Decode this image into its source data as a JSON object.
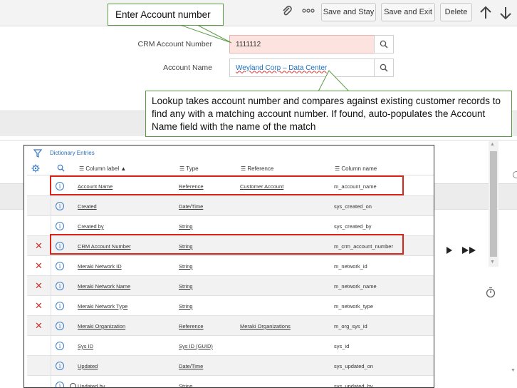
{
  "toolbar": {
    "save_stay_label": "Save and Stay",
    "save_exit_label": "Save and Exit",
    "delete_label": "Delete",
    "more_icon": "more-icon",
    "attach_icon": "paperclip-icon"
  },
  "form": {
    "crm_label": "CRM Account Number",
    "crm_value": "1111112",
    "account_label": "Account Name",
    "account_value": "Weyland Corp – Data Center"
  },
  "callouts": {
    "enter_account": "Enter Account number",
    "lookup_note": "Lookup takes account number and compares against existing customer records to find any with a matching account number.  If found, auto-populates the Account Name field with the name of the match"
  },
  "dictionary": {
    "title": "Dictionary Entries",
    "headers": {
      "column_label": "Column label ▲",
      "type": "Type",
      "reference": "Reference",
      "column_name": "Column name"
    },
    "rows": [
      {
        "deletable": false,
        "label": "Account Name",
        "type": "Reference",
        "reference": "Customer Account",
        "name": "m_account_name"
      },
      {
        "deletable": false,
        "label": "Created",
        "type": "Date/Time",
        "reference": "",
        "name": "sys_created_on"
      },
      {
        "deletable": false,
        "label": "Created by",
        "type": "String",
        "reference": "",
        "name": "sys_created_by"
      },
      {
        "deletable": true,
        "label": "CRM Account Number",
        "type": "String",
        "reference": "",
        "name": "m_crm_account_number"
      },
      {
        "deletable": true,
        "label": "Meraki Network ID",
        "type": "String",
        "reference": "",
        "name": "m_network_id"
      },
      {
        "deletable": true,
        "label": "Meraki Network Name",
        "type": "String",
        "reference": "",
        "name": "m_network_name"
      },
      {
        "deletable": true,
        "label": "Meraki Network Type",
        "type": "String",
        "reference": "",
        "name": "m_network_type"
      },
      {
        "deletable": true,
        "label": "Meraki Organization",
        "type": "Reference",
        "reference": "Meraki Organizations",
        "name": "m_org_sys_id"
      },
      {
        "deletable": false,
        "label": "Sys ID",
        "type": "Sys ID (GUID)",
        "reference": "",
        "name": "sys_id"
      },
      {
        "deletable": false,
        "label": "Updated",
        "type": "Date/Time",
        "reference": "",
        "name": "sys_updated_on"
      },
      {
        "deletable": false,
        "label": "Updated by",
        "type": "String",
        "reference": "",
        "name": "sys_updated_by"
      }
    ]
  },
  "colors": {
    "highlight": "#d9241c",
    "callout_border": "#5b9b45",
    "link_blue": "#2a6ebb",
    "delete_red": "#d0302b",
    "crm_field_bg": "#fde3e0"
  }
}
